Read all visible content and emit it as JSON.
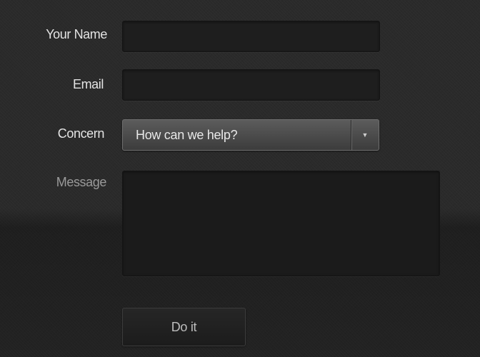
{
  "form": {
    "name_label": "Your Name",
    "email_label": "Email",
    "concern_label": "Concern",
    "message_label": "Message",
    "name_value": "",
    "email_value": "",
    "concern_selected": "How can we help?",
    "message_value": "",
    "submit_label": "Do it",
    "dropdown_icon": "triangle-down-icon"
  }
}
